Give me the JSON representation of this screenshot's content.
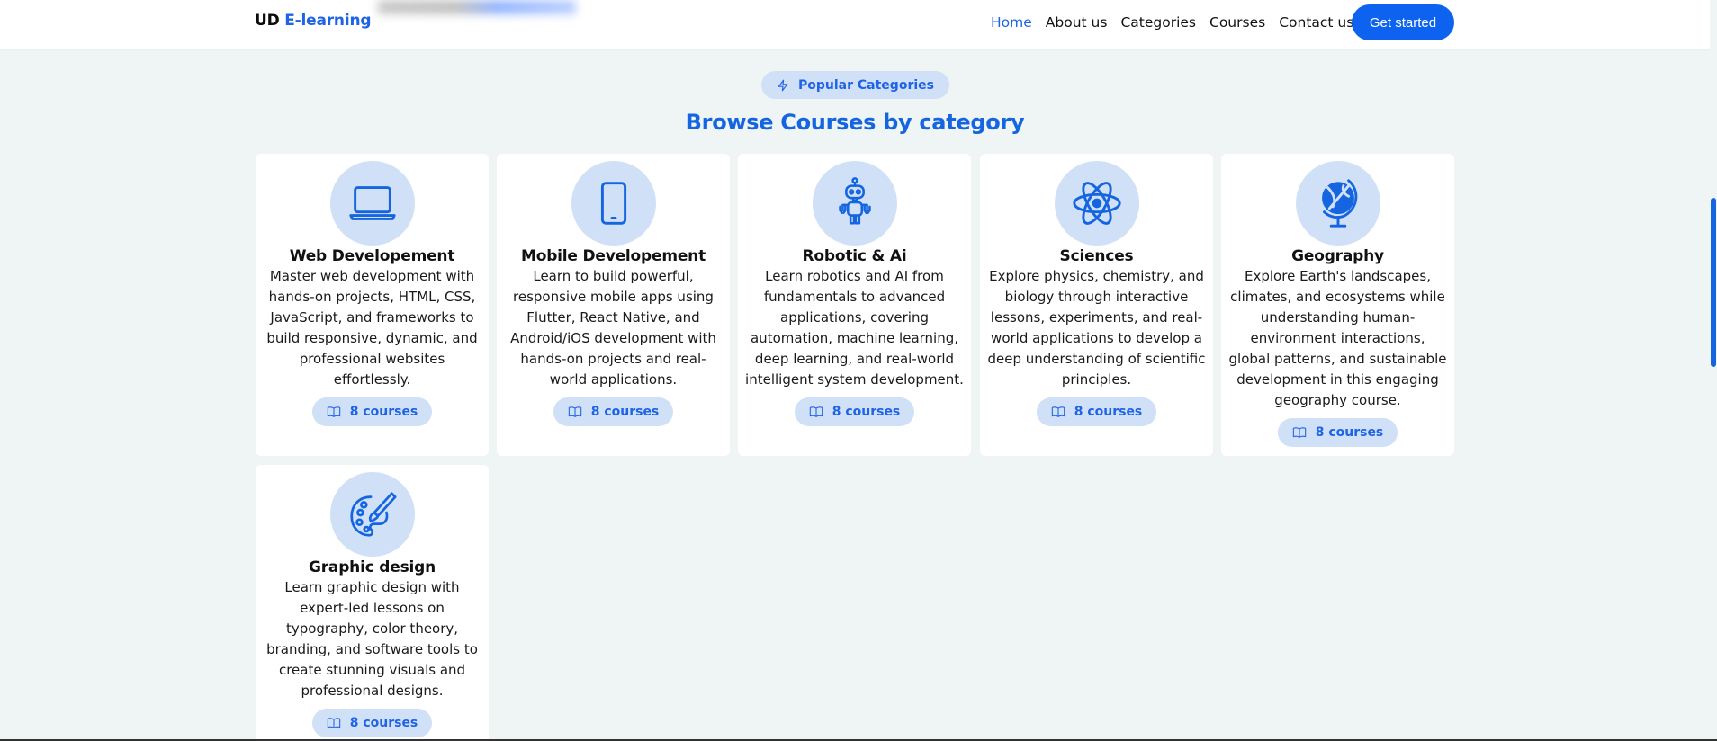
{
  "header": {
    "logo_part1": "UD",
    "logo_part2": "E-learning",
    "nav": [
      "Home",
      "About us",
      "Categories",
      "Courses",
      "Contact us"
    ],
    "active_nav": "Home",
    "cta_label": "Get started"
  },
  "section": {
    "pill_label": "Popular Categories",
    "pill_icon": "bolt-icon",
    "title": "Browse Courses by category"
  },
  "categories": [
    {
      "title": "Web Developement",
      "icon": "laptop-icon",
      "description": "Master web development with hands-on projects, HTML, CSS, JavaScript, and frameworks to build responsive, dynamic, and professional websites effortlessly.",
      "courses": "8 courses"
    },
    {
      "title": "Mobile Developement",
      "icon": "smartphone-icon",
      "description": "Learn to build powerful, responsive mobile apps using Flutter, React Native, and Android/iOS development with hands-on projects and real-world applications.",
      "courses": "8 courses"
    },
    {
      "title": "Robotic & Ai",
      "icon": "robot-icon",
      "description": "Learn robotics and AI from fundamentals to advanced applications, covering automation, machine learning, deep learning, and real-world intelligent system development.",
      "courses": "8 courses"
    },
    {
      "title": "Sciences",
      "icon": "atom-icon",
      "description": "Explore physics, chemistry, and biology through interactive lessons, experiments, and real-world applications to develop a deep understanding of scientific principles.",
      "courses": "8 courses"
    },
    {
      "title": "Geography",
      "icon": "globe-icon",
      "description": "Explore Earth's landscapes, climates, and ecosystems while understanding human-environment interactions, global patterns, and sustainable development in this engaging geography course.",
      "courses": "8 courses"
    },
    {
      "title": "Graphic design",
      "icon": "palette-brush-icon",
      "description": "Learn graphic design with expert-led lessons on typography, color theory, branding, and software tools to create stunning visuals and professional designs.",
      "courses": "8 courses"
    }
  ],
  "colors": {
    "accent": "#1f63e6",
    "cta": "#0d63ef",
    "icon_bg": "#cfe0f7",
    "page_bg": "#eef5f4"
  }
}
